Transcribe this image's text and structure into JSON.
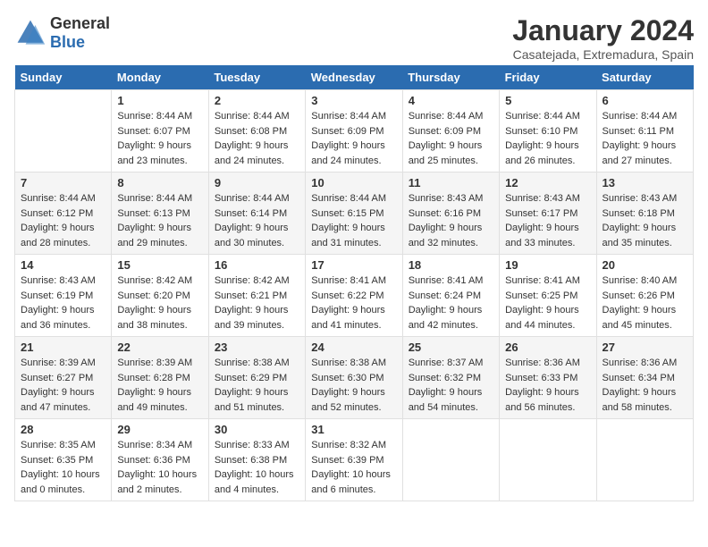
{
  "header": {
    "logo_general": "General",
    "logo_blue": "Blue",
    "month_title": "January 2024",
    "location": "Casatejada, Extremadura, Spain"
  },
  "days_of_week": [
    "Sunday",
    "Monday",
    "Tuesday",
    "Wednesday",
    "Thursday",
    "Friday",
    "Saturday"
  ],
  "weeks": [
    [
      {
        "day": "",
        "info": ""
      },
      {
        "day": "1",
        "info": "Sunrise: 8:44 AM\nSunset: 6:07 PM\nDaylight: 9 hours\nand 23 minutes."
      },
      {
        "day": "2",
        "info": "Sunrise: 8:44 AM\nSunset: 6:08 PM\nDaylight: 9 hours\nand 24 minutes."
      },
      {
        "day": "3",
        "info": "Sunrise: 8:44 AM\nSunset: 6:09 PM\nDaylight: 9 hours\nand 24 minutes."
      },
      {
        "day": "4",
        "info": "Sunrise: 8:44 AM\nSunset: 6:09 PM\nDaylight: 9 hours\nand 25 minutes."
      },
      {
        "day": "5",
        "info": "Sunrise: 8:44 AM\nSunset: 6:10 PM\nDaylight: 9 hours\nand 26 minutes."
      },
      {
        "day": "6",
        "info": "Sunrise: 8:44 AM\nSunset: 6:11 PM\nDaylight: 9 hours\nand 27 minutes."
      }
    ],
    [
      {
        "day": "7",
        "info": "Sunrise: 8:44 AM\nSunset: 6:12 PM\nDaylight: 9 hours\nand 28 minutes."
      },
      {
        "day": "8",
        "info": "Sunrise: 8:44 AM\nSunset: 6:13 PM\nDaylight: 9 hours\nand 29 minutes."
      },
      {
        "day": "9",
        "info": "Sunrise: 8:44 AM\nSunset: 6:14 PM\nDaylight: 9 hours\nand 30 minutes."
      },
      {
        "day": "10",
        "info": "Sunrise: 8:44 AM\nSunset: 6:15 PM\nDaylight: 9 hours\nand 31 minutes."
      },
      {
        "day": "11",
        "info": "Sunrise: 8:43 AM\nSunset: 6:16 PM\nDaylight: 9 hours\nand 32 minutes."
      },
      {
        "day": "12",
        "info": "Sunrise: 8:43 AM\nSunset: 6:17 PM\nDaylight: 9 hours\nand 33 minutes."
      },
      {
        "day": "13",
        "info": "Sunrise: 8:43 AM\nSunset: 6:18 PM\nDaylight: 9 hours\nand 35 minutes."
      }
    ],
    [
      {
        "day": "14",
        "info": "Sunrise: 8:43 AM\nSunset: 6:19 PM\nDaylight: 9 hours\nand 36 minutes."
      },
      {
        "day": "15",
        "info": "Sunrise: 8:42 AM\nSunset: 6:20 PM\nDaylight: 9 hours\nand 38 minutes."
      },
      {
        "day": "16",
        "info": "Sunrise: 8:42 AM\nSunset: 6:21 PM\nDaylight: 9 hours\nand 39 minutes."
      },
      {
        "day": "17",
        "info": "Sunrise: 8:41 AM\nSunset: 6:22 PM\nDaylight: 9 hours\nand 41 minutes."
      },
      {
        "day": "18",
        "info": "Sunrise: 8:41 AM\nSunset: 6:24 PM\nDaylight: 9 hours\nand 42 minutes."
      },
      {
        "day": "19",
        "info": "Sunrise: 8:41 AM\nSunset: 6:25 PM\nDaylight: 9 hours\nand 44 minutes."
      },
      {
        "day": "20",
        "info": "Sunrise: 8:40 AM\nSunset: 6:26 PM\nDaylight: 9 hours\nand 45 minutes."
      }
    ],
    [
      {
        "day": "21",
        "info": "Sunrise: 8:39 AM\nSunset: 6:27 PM\nDaylight: 9 hours\nand 47 minutes."
      },
      {
        "day": "22",
        "info": "Sunrise: 8:39 AM\nSunset: 6:28 PM\nDaylight: 9 hours\nand 49 minutes."
      },
      {
        "day": "23",
        "info": "Sunrise: 8:38 AM\nSunset: 6:29 PM\nDaylight: 9 hours\nand 51 minutes."
      },
      {
        "day": "24",
        "info": "Sunrise: 8:38 AM\nSunset: 6:30 PM\nDaylight: 9 hours\nand 52 minutes."
      },
      {
        "day": "25",
        "info": "Sunrise: 8:37 AM\nSunset: 6:32 PM\nDaylight: 9 hours\nand 54 minutes."
      },
      {
        "day": "26",
        "info": "Sunrise: 8:36 AM\nSunset: 6:33 PM\nDaylight: 9 hours\nand 56 minutes."
      },
      {
        "day": "27",
        "info": "Sunrise: 8:36 AM\nSunset: 6:34 PM\nDaylight: 9 hours\nand 58 minutes."
      }
    ],
    [
      {
        "day": "28",
        "info": "Sunrise: 8:35 AM\nSunset: 6:35 PM\nDaylight: 10 hours\nand 0 minutes."
      },
      {
        "day": "29",
        "info": "Sunrise: 8:34 AM\nSunset: 6:36 PM\nDaylight: 10 hours\nand 2 minutes."
      },
      {
        "day": "30",
        "info": "Sunrise: 8:33 AM\nSunset: 6:38 PM\nDaylight: 10 hours\nand 4 minutes."
      },
      {
        "day": "31",
        "info": "Sunrise: 8:32 AM\nSunset: 6:39 PM\nDaylight: 10 hours\nand 6 minutes."
      },
      {
        "day": "",
        "info": ""
      },
      {
        "day": "",
        "info": ""
      },
      {
        "day": "",
        "info": ""
      }
    ]
  ]
}
